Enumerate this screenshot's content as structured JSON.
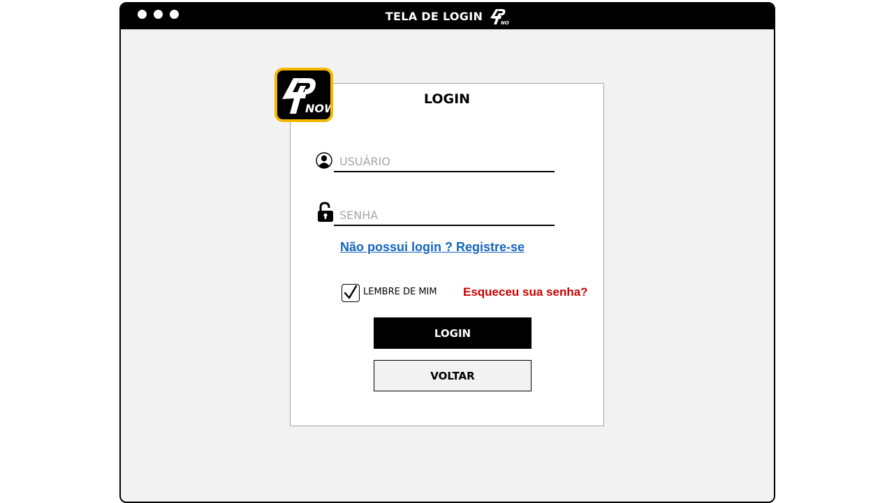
{
  "window": {
    "title": "TELA DE LOGIN",
    "controls": [
      "dot",
      "dot",
      "dot"
    ]
  },
  "brand": {
    "logo_text": "NOW",
    "logo_icon": "4p-now-logo",
    "badge_border_color": "#f5b800"
  },
  "login_form": {
    "title": "LOGIN",
    "username": {
      "icon": "user-circle-icon",
      "placeholder": "USUÁRIO",
      "value": ""
    },
    "password": {
      "icon": "unlock-icon",
      "placeholder": "SENHA",
      "value": ""
    },
    "register_link": "Não possui login ? Registre-se",
    "remember_me": {
      "label": "LEMBRE DE MIM",
      "checked": true
    },
    "forgot_link": "Esqueceu sua senha?",
    "login_button": "LOGIN",
    "back_button": "VOLTAR"
  },
  "colors": {
    "link_blue": "#1565c0",
    "link_red": "#cc0000",
    "placeholder_gray": "#a6a6a6",
    "window_bg": "#f2f2f2"
  }
}
